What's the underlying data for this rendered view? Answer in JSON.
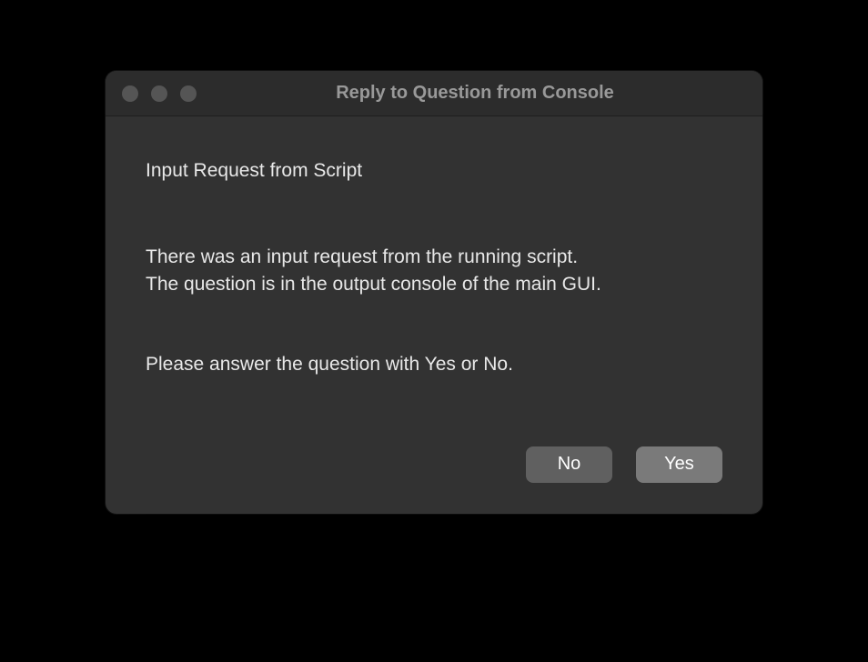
{
  "dialog": {
    "title": "Reply to Question from Console",
    "heading": "Input Request from Script",
    "body_line1": "There was an input request from the running script.",
    "body_line2": "The question is in the output console of the main GUI.",
    "instruction": "Please answer the question with Yes or No.",
    "buttons": {
      "no": "No",
      "yes": "Yes"
    }
  }
}
